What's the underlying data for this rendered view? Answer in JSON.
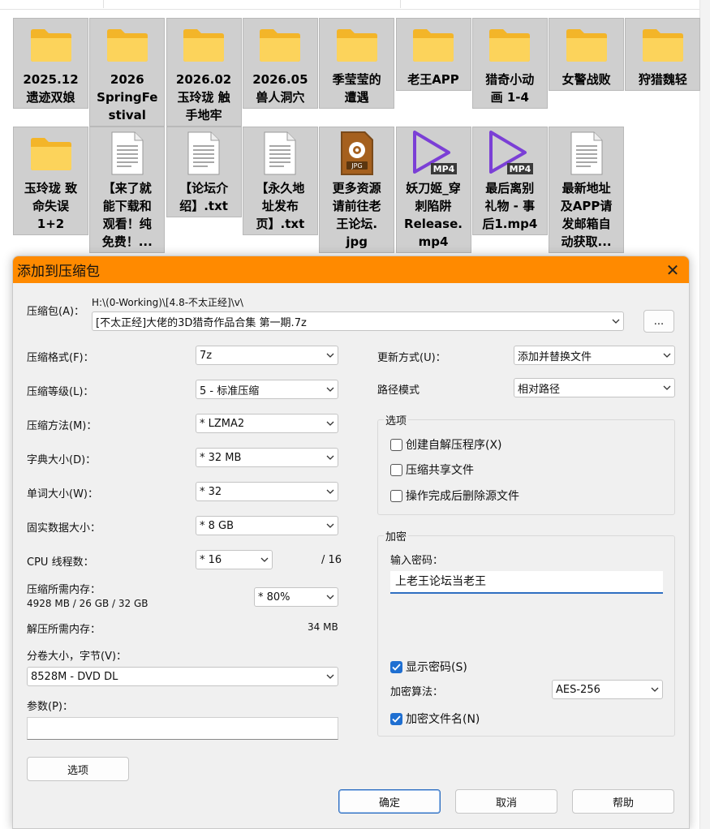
{
  "explorer": {
    "row1": [
      {
        "name": "2025.12\n遗迹双娘",
        "icon": "folder-icon"
      },
      {
        "name": "2026\nSpringFe\nstival",
        "icon": "folder-icon"
      },
      {
        "name": "2026.02\n玉玲珑 触\n手地牢",
        "icon": "folder-icon"
      },
      {
        "name": "2026.05\n兽人洞穴",
        "icon": "folder-icon"
      },
      {
        "name": "季莹莹的\n遭遇",
        "icon": "folder-icon"
      },
      {
        "name": "老王APP",
        "icon": "folder-icon"
      },
      {
        "name": "猎奇小动\n画 1-4",
        "icon": "folder-icon"
      },
      {
        "name": "女警战败",
        "icon": "folder-icon"
      },
      {
        "name": "狩猎魏轻",
        "icon": "folder-icon"
      }
    ],
    "row2": [
      {
        "name": "玉玲珑 致\n命失误\n1+2",
        "icon": "folder-icon"
      },
      {
        "name": "【来了就\n能下载和\n观看！纯\n免费！...",
        "icon": "text-file-icon"
      },
      {
        "name": "【论坛介\n绍】.txt",
        "icon": "text-file-icon"
      },
      {
        "name": "【永久地\n址发布\n页】.txt",
        "icon": "text-file-icon"
      },
      {
        "name": "更多资源\n请前往老\n王论坛.\njpg",
        "icon": "jpg-file-icon"
      },
      {
        "name": "妖刀姬_穿\n刺陷阱\nRelease.\nmp4",
        "icon": "mp4-file-icon"
      },
      {
        "name": "最后离别\n礼物 - 事\n后1.mp4",
        "icon": "mp4-file-icon"
      },
      {
        "name": "最新地址\n及APP请\n发邮箱自\n动获取...",
        "icon": "text-file-icon"
      }
    ],
    "jpg_badge": "JPG",
    "mp4_badge": "MP4"
  },
  "dialog": {
    "title": "添加到压缩包",
    "archive_label": "压缩包(A)：",
    "archive_path": "H:\\(0-Working)\\[4.8-不太正经]\\v\\",
    "archive_name": "[不太正经]大佬的3D猎奇作品合集 第一期.7z",
    "browse_label": "...",
    "format_label": "压缩格式(F)：",
    "format_value": "7z",
    "level_label": "压缩等级(L)：",
    "level_value": "5 - 标准压缩",
    "method_label": "压缩方法(M)：",
    "method_value": "*  LZMA2",
    "dict_label": "字典大小(D)：",
    "dict_value": "*  32 MB",
    "word_label": "单词大小(W)：",
    "word_value": "*  32",
    "solid_label": "固实数据大小：",
    "solid_value": "*  8 GB",
    "cpu_label": "CPU 线程数：",
    "cpu_value": "*  16",
    "cpu_total": "/ 16",
    "mem_label": "压缩所需内存：",
    "mem_value": "4928 MB / 26 GB / 32 GB",
    "mem_pct": "*  80%",
    "decomp_label": "解压所需内存：",
    "decomp_value": "34 MB",
    "volume_label": "分卷大小，字节(V)：",
    "volume_value": "8528M - DVD DL",
    "params_label": "参数(P)：",
    "params_value": "",
    "options_button": "选项",
    "update_label": "更新方式(U)：",
    "update_value": "添加并替换文件",
    "path_label": "路径模式",
    "path_value": "相对路径",
    "options_group": "选项",
    "opt_sfx": "创建自解压程序(X)",
    "opt_shared": "压缩共享文件",
    "opt_delete": "操作完成后删除源文件",
    "encrypt_group": "加密",
    "password_label": "输入密码：",
    "password_value": "上老王论坛当老王",
    "show_password": "显示密码(S)",
    "enc_method_label": "加密算法：",
    "enc_method_value": "AES-256",
    "encrypt_names": "加密文件名(N)",
    "ok_button": "确定",
    "cancel_button": "取消",
    "help_button": "帮助"
  },
  "colors": {
    "titlebar": "#ff8a00",
    "checkbox": "#1f6fd1",
    "focus": "#2f6fc1"
  }
}
